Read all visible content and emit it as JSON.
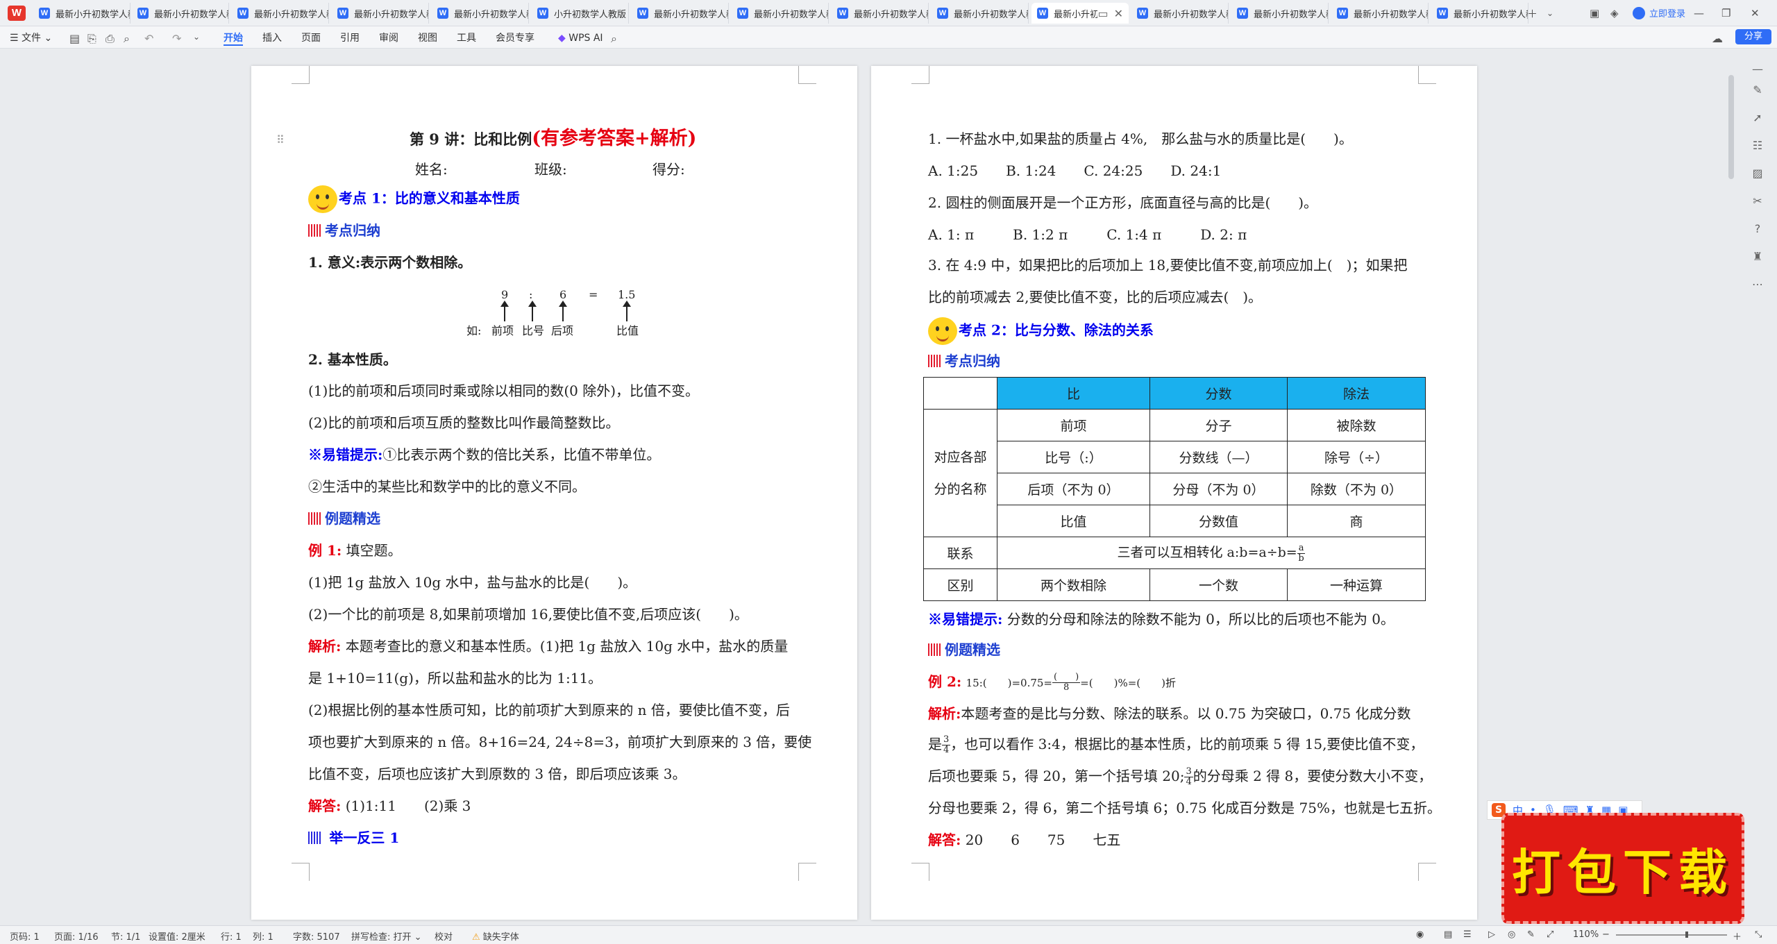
{
  "window": {
    "tabs": [
      {
        "label": "最新小升初数学人教",
        "active": false
      },
      {
        "label": "最新小升初数学人教",
        "active": false
      },
      {
        "label": "最新小升初数学人教",
        "active": false
      },
      {
        "label": "最新小升初数学人教",
        "active": false
      },
      {
        "label": "最新小升初数学人教",
        "active": false
      },
      {
        "label": "小升初数学人教版",
        "active": false
      },
      {
        "label": "最新小升初数学人教",
        "active": false
      },
      {
        "label": "最新小升初数学人教",
        "active": false
      },
      {
        "label": "最新小升初数学人教",
        "active": false
      },
      {
        "label": "最新小升初数学人教",
        "active": false
      },
      {
        "label": "最新小升初",
        "active": true
      },
      {
        "label": "最新小升初数学人教",
        "active": false
      },
      {
        "label": "最新小升初数学人教",
        "active": false
      },
      {
        "label": "最新小升初数学人教",
        "active": false
      },
      {
        "label": "最新小升初数学人教",
        "active": false
      }
    ],
    "login_label": "立即登录",
    "share_label": "分享"
  },
  "menu": {
    "file_label": "文件",
    "items": [
      "开始",
      "插入",
      "页面",
      "引用",
      "审阅",
      "视图",
      "工具",
      "会员专享"
    ],
    "active_item": "开始",
    "wps_ai_label": "WPS AI"
  },
  "left_page": {
    "title": "第 9 讲：比和比例",
    "title_red": "(有参考答案+解析)",
    "name_label": "姓名:",
    "class_label": "班级:",
    "score_label": "得分:",
    "section1_title": "考点 1：比的意义和基本性质",
    "summary_heading": "考点归纳",
    "meaning": "1. 意义:表示两个数相除。",
    "ratio_diagram": {
      "front": "9",
      "colon": ":",
      "back": "6",
      "equals": "=",
      "value": "1.5",
      "caption_prefix": "如:",
      "front_label": "前项",
      "sign_label": "比号",
      "back_label": "后项",
      "value_label": "比值"
    },
    "property_heading": "2. 基本性质。",
    "property_1": "(1)比的前项和后项同时乘或除以相同的数(0 除外)，比值不变。",
    "property_2": "(2)比的前项和后项互质的整数比叫作最简整数比。",
    "error_tip_label": "※易错提示:",
    "error_tip_1": "①比表示两个数的倍比关系，比值不带单位。",
    "error_tip_2": "②生活中的某些比和数学中的比的意义不同。",
    "examples_heading": "例题精选",
    "example1_label": "例 1:",
    "example1_text": "填空题。",
    "example1_q1": "(1)把 1g 盐放入 10g 水中，盐与盐水的比是(　　)。",
    "example1_q2": "(2)一个比的前项是 8,如果前项增加 16,要使比值不变,后项应该(　　)。",
    "analysis_label": "解析:",
    "analysis_1": "本题考查比的意义和基本性质。(1)把 1g 盐放入 10g 水中，盐水的质量",
    "analysis_2": "是 1+10=11(g)，所以盐和盐水的比为 1:11。",
    "analysis_3": "(2)根据比例的基本性质可知，比的前项扩大到原来的 n 倍，要使比值不变，后",
    "analysis_4": "项也要扩大到原来的 n 倍。8+16=24, 24÷8=3，前项扩大到原来的 3 倍，要使",
    "analysis_5": "比值不变，后项也应该扩大到原数的 3 倍，即后项应该乘 3。",
    "answer_label": "解答:",
    "answer_text": "(1)1:11　　(2)乘 3",
    "practice_heading": "举一反三 1"
  },
  "right_page": {
    "q1": "1. 一杯盐水中,如果盐的质量占 4%,　那么盐与水的质量比是(　　)。",
    "q1_options": [
      "A. 1:25",
      "B. 1:24",
      "C. 24:25",
      "D. 24:1"
    ],
    "q2": "2. 圆柱的侧面展开是一个正方形，底面直径与高的比是(　　)。",
    "q2_options": [
      "A. 1: π",
      "B. 1:2 π",
      "C. 1:4 π",
      "D. 2: π"
    ],
    "q3_line1": "3. 在 4:9 中，如果把比的后项加上 18,要使比值不变,前项应加上(　)；如果把",
    "q3_line2": "比的前项减去 2,要使比值不变，比的后项应减去(　)。",
    "section2_title": "考点 2：比与分数、除法的关系",
    "summary_heading": "考点归纳",
    "table": {
      "headers": [
        "比",
        "分数",
        "除法"
      ],
      "row_label": "对应各部分的名称",
      "rows": [
        [
          "前项",
          "分子",
          "被除数"
        ],
        [
          "比号（:）",
          "分数线（—）",
          "除号（÷）"
        ],
        [
          "后项（不为 0）",
          "分母（不为 0）",
          "除数（不为 0）"
        ],
        [
          "比值",
          "分数值",
          "商"
        ]
      ],
      "relation_label": "联系",
      "relation_text": "三者可以互相转化 a:b=a÷b=",
      "relation_frac_num": "a",
      "relation_frac_den": "b",
      "diff_label": "区别",
      "diff": [
        "两个数相除",
        "一个数",
        "一种运算"
      ]
    },
    "error_tip_label": "※易错提示:",
    "error_tip_text": "分数的分母和除法的除数不能为 0，所以比的后项也不能为 0。",
    "examples_heading": "例题精选",
    "example2_label": "例 2:",
    "example2_a": "15:(　　)=0.75=",
    "example2_frac_num": "(　　)",
    "example2_frac_den": "8",
    "example2_b": "=(　　)%=(　　)折",
    "analysis_label": "解析:",
    "analysis_1": "本题考查的是比与分数、除法的联系。以 0.75 为突破口，0.75 化成分数",
    "analysis_2a": "是",
    "analysis_2_frac_num": "3",
    "analysis_2_frac_den": "4",
    "analysis_2b": "，也可以看作 3:4，根据比的基本性质，比的前项乘 5 得 15,要使比值不变，",
    "analysis_3a": "后项也要乘 5，得 20，第一个括号填 20;",
    "analysis_3_frac_num": "3",
    "analysis_3_frac_den": "4",
    "analysis_3b": "的分母乘 2 得 8，要使分数大小不变，",
    "analysis_4": "分母也要乘 2，得 6，第二个括号填 6；0.75 化成百分数是 75%，也就是七五折。",
    "answer_label": "解答:",
    "answer_text": "20　　6　　75　　七五"
  },
  "status_bar": {
    "page": "页码: 1",
    "pages": "页面: 1/16",
    "section": "节: 1/1",
    "setting": "设置值: 2厘米",
    "row": "行: 1",
    "col": "列: 1",
    "words": "字数: 5107",
    "spell": "拼写检查: 打开",
    "proof": "校对",
    "missing_font": "缺失字体",
    "zoom": "110%"
  },
  "overlay": {
    "ime_label": "中",
    "banner_text": "打包下载"
  }
}
